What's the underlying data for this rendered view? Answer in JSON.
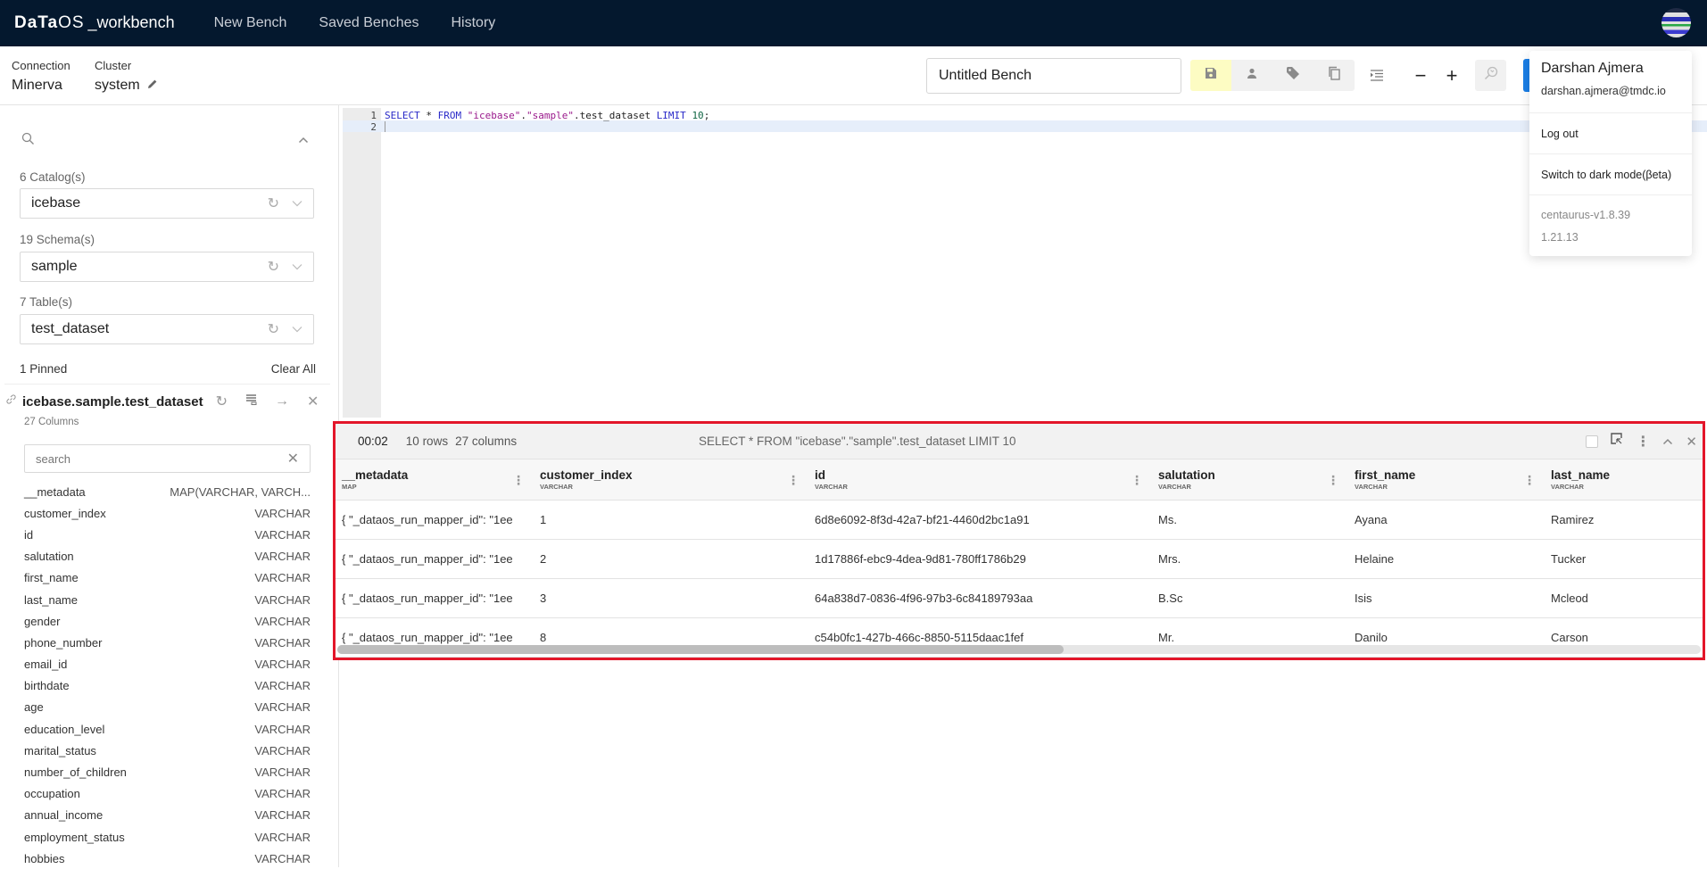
{
  "app": {
    "brand": "DaTa",
    "brand_os": "OS",
    "product": "_workbench"
  },
  "nav": [
    {
      "label": "New Bench"
    },
    {
      "label": "Saved Benches"
    },
    {
      "label": "History"
    }
  ],
  "context": {
    "connection_label": "Connection",
    "connection_value": "Minerva",
    "cluster_label": "Cluster",
    "cluster_value": "system"
  },
  "toolbar": {
    "bench_name": "Untitled Bench",
    "buttons": [
      "save-icon",
      "user-icon",
      "tag-icon",
      "copy-icon",
      "format-indent-icon",
      "zoom-out-icon",
      "zoom-in-icon",
      "explain-icon"
    ],
    "zoom_out": "−",
    "zoom_in": "+"
  },
  "sidebar": {
    "catalog_label": "6 Catalog(s)",
    "catalog_value": "icebase",
    "schema_label": "19 Schema(s)",
    "schema_value": "sample",
    "table_label": "7 Table(s)",
    "table_value": "test_dataset",
    "pinned_label": "1 Pinned",
    "clear_all": "Clear All",
    "pinned_table": "icebase.sample.test_dataset",
    "column_count": "27 Columns",
    "column_search_placeholder": "search",
    "columns": [
      {
        "name": "__metadata",
        "type": "MAP(VARCHAR, VARCH..."
      },
      {
        "name": "customer_index",
        "type": "VARCHAR"
      },
      {
        "name": "id",
        "type": "VARCHAR"
      },
      {
        "name": "salutation",
        "type": "VARCHAR"
      },
      {
        "name": "first_name",
        "type": "VARCHAR"
      },
      {
        "name": "last_name",
        "type": "VARCHAR"
      },
      {
        "name": "gender",
        "type": "VARCHAR"
      },
      {
        "name": "phone_number",
        "type": "VARCHAR"
      },
      {
        "name": "email_id",
        "type": "VARCHAR"
      },
      {
        "name": "birthdate",
        "type": "VARCHAR"
      },
      {
        "name": "age",
        "type": "VARCHAR"
      },
      {
        "name": "education_level",
        "type": "VARCHAR"
      },
      {
        "name": "marital_status",
        "type": "VARCHAR"
      },
      {
        "name": "number_of_children",
        "type": "VARCHAR"
      },
      {
        "name": "occupation",
        "type": "VARCHAR"
      },
      {
        "name": "annual_income",
        "type": "VARCHAR"
      },
      {
        "name": "employment_status",
        "type": "VARCHAR"
      },
      {
        "name": "hobbies",
        "type": "VARCHAR"
      }
    ]
  },
  "editor": {
    "line_numbers": [
      "1",
      "2"
    ],
    "tokens": [
      {
        "t": "SELECT",
        "c": "kw"
      },
      {
        "t": " * ",
        "c": ""
      },
      {
        "t": "FROM",
        "c": "kw"
      },
      {
        "t": " ",
        "c": ""
      },
      {
        "t": "\"icebase\"",
        "c": "str"
      },
      {
        "t": ".",
        "c": ""
      },
      {
        "t": "\"sample\"",
        "c": "str"
      },
      {
        "t": ".test_dataset ",
        "c": ""
      },
      {
        "t": "LIMIT",
        "c": "kw"
      },
      {
        "t": " ",
        "c": ""
      },
      {
        "t": "10",
        "c": "num"
      },
      {
        "t": ";",
        "c": ""
      }
    ]
  },
  "results": {
    "elapsed": "00:02",
    "rows": "10 rows",
    "columns": "27 columns",
    "query": "SELECT * FROM \"icebase\".\"sample\".test_dataset LIMIT 10",
    "headers": [
      {
        "name": "__metadata",
        "type": "MAP"
      },
      {
        "name": "customer_index",
        "type": "VARCHAR"
      },
      {
        "name": "id",
        "type": "VARCHAR"
      },
      {
        "name": "salutation",
        "type": "VARCHAR"
      },
      {
        "name": "first_name",
        "type": "VARCHAR"
      },
      {
        "name": "last_name",
        "type": "VARCHAR"
      }
    ],
    "rows_data": [
      [
        "{ \"_dataos_run_mapper_id\": \"1ee",
        "1",
        "6d8e6092-8f3d-42a7-bf21-4460d2bc1a91",
        "Ms.",
        "Ayana",
        "Ramirez"
      ],
      [
        "{ \"_dataos_run_mapper_id\": \"1ee",
        "2",
        "1d17886f-ebc9-4dea-9d81-780ff1786b29",
        "Mrs.",
        "Helaine",
        "Tucker"
      ],
      [
        "{ \"_dataos_run_mapper_id\": \"1ee",
        "3",
        "64a838d7-0836-4f96-97b3-6c84189793aa",
        "B.Sc",
        "Isis",
        "Mcleod"
      ],
      [
        "{ \"_dataos_run_mapper_id\": \"1ee",
        "8",
        "c54b0fc1-427b-466c-8850-5115daac1fef",
        "Mr.",
        "Danilo",
        "Carson"
      ]
    ]
  },
  "user_menu": {
    "name": "Darshan Ajmera",
    "email": "darshan.ajmera@tmdc.io",
    "logout": "Log out",
    "dark_mode": "Switch to dark mode(βeta)",
    "version": "centaurus-v1.8.39",
    "build": "1.21.13"
  },
  "colors": {
    "topbar": "#04182e",
    "highlight_border": "#e3162a",
    "save_button": "#fdfcc3",
    "run_button": "#1a7ee6"
  }
}
